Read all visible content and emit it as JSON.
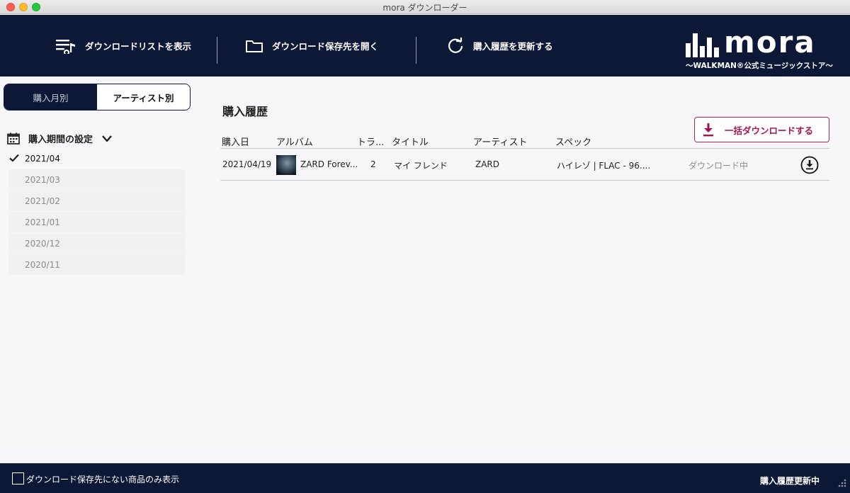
{
  "window": {
    "title": "mora ダウンローダー"
  },
  "toolbar": {
    "show_list": "ダウンロードリストを表示",
    "open_folder": "ダウンロード保存先を開く",
    "refresh": "購入履歴を更新する"
  },
  "logo": {
    "word": "mora",
    "sub": "〜WALKMAN®公式ミュージックストア〜"
  },
  "sidebar": {
    "tabs": [
      {
        "label": "購入月別",
        "active": false
      },
      {
        "label": "アーティスト別",
        "active": true
      }
    ],
    "period_label": "購入期間の設定",
    "months": [
      {
        "label": "2021/04",
        "selected": true
      },
      {
        "label": "2021/03",
        "selected": false
      },
      {
        "label": "2021/02",
        "selected": false
      },
      {
        "label": "2021/01",
        "selected": false
      },
      {
        "label": "2020/12",
        "selected": false
      },
      {
        "label": "2020/11",
        "selected": false
      }
    ]
  },
  "main": {
    "title": "購入履歴",
    "bulk_download": "一括ダウンロードする",
    "columns": [
      "購入日",
      "アルバム",
      "トラ...",
      "タイトル",
      "アーティスト",
      "スペック"
    ],
    "rows": [
      {
        "date": "2021/04/19",
        "album": "ZARD Forev...",
        "track": "2",
        "title": "マイ フレンド",
        "artist": "ZARD",
        "spec": "ハイレゾ | FLAC - 96....",
        "status": "ダウンロード中"
      }
    ]
  },
  "footer": {
    "filter_label": "ダウンロード保存先にない商品のみ表示",
    "filter_checked": false,
    "status": "購入履歴更新中"
  },
  "colors": {
    "navy": "#0d1736",
    "accent": "#a11552",
    "muted": "#8a8a8a"
  },
  "icons": [
    "playlist-icon",
    "folder-icon",
    "refresh-icon",
    "calendar-icon",
    "chevron-down-icon",
    "check-icon",
    "download-icon",
    "download-circle-icon",
    "resize-grip-icon"
  ]
}
